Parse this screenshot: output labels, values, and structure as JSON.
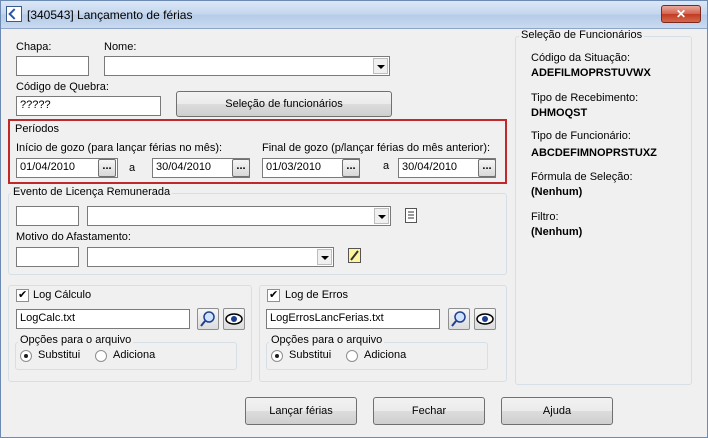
{
  "window": {
    "title": "[340543]  Lançamento de férias",
    "close_glyph": "✕"
  },
  "chapa": {
    "label": "Chapa:",
    "value": ""
  },
  "nome": {
    "label": "Nome:",
    "value": ""
  },
  "codigo_quebra": {
    "label": "Código de Quebra:",
    "value": "?????"
  },
  "selecao_button": "Seleção de funcionários",
  "periodos": {
    "title": "Períodos",
    "inicio_label": "Início de gozo (para lançar férias no mês):",
    "inicio_from": "01/04/2010",
    "inicio_to": "30/04/2010",
    "final_label": "Final de gozo (p/lançar férias do mês anterior):",
    "final_from": "01/03/2010",
    "final_to": "30/04/2010",
    "range_sep": "a",
    "dots": "..."
  },
  "evento": {
    "title": "Evento de Licença Remunerada",
    "code": "",
    "value": "",
    "motivo_label": "Motivo do Afastamento:",
    "motivo_code": "",
    "motivo_value": ""
  },
  "log_calculo": {
    "checkbox_label": "Log Cálculo",
    "file": "LogCalc.txt",
    "options_title": "Opções para o arquivo",
    "substitui": "Substitui",
    "adiciona": "Adiciona"
  },
  "log_erros": {
    "checkbox_label": "Log de Erros",
    "file": "LogErrosLancFerias.txt",
    "options_title": "Opções para o arquivo",
    "substitui": "Substitui",
    "adiciona": "Adiciona"
  },
  "selecao_panel": {
    "title": "Seleção de Funcionários",
    "codigo_situacao_label": "Código da Situação:",
    "codigo_situacao_value": "ADEFILMOPRSTUVWX",
    "tipo_recebimento_label": "Tipo de Recebimento:",
    "tipo_recebimento_value": "DHMOQST",
    "tipo_funcionario_label": "Tipo de Funcionário:",
    "tipo_funcionario_value": "ABCDEFIMNOPRSTUXZ",
    "formula_label": "Fórmula de Seleção:",
    "formula_value": "(Nenhum)",
    "filtro_label": "Filtro:",
    "filtro_value": "(Nenhum)"
  },
  "buttons": {
    "lancar": "Lançar férias",
    "fechar": "Fechar",
    "ajuda": "Ajuda"
  }
}
